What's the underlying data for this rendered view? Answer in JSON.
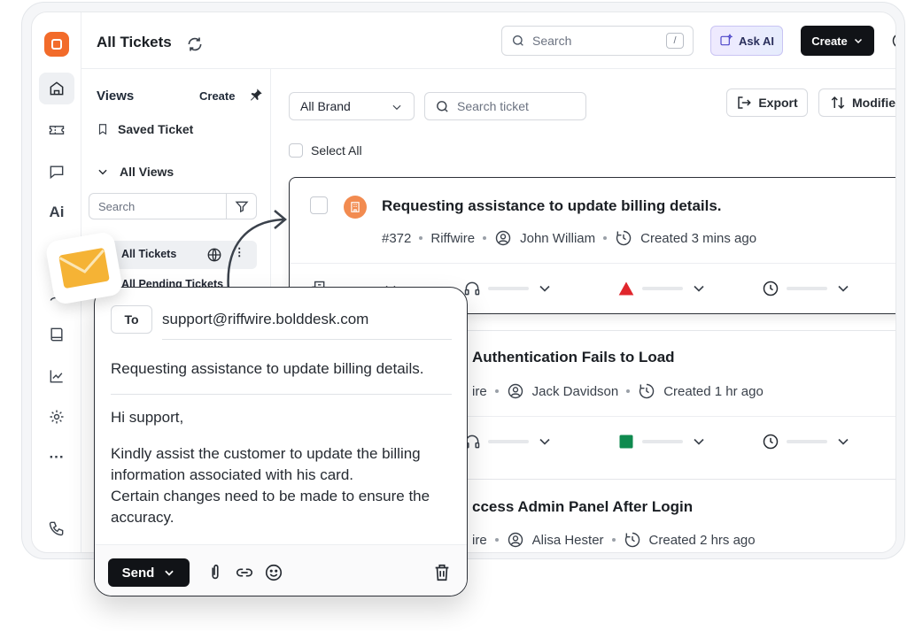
{
  "header": {
    "title": "All Tickets",
    "search_placeholder": "Search",
    "search_shortcut": "/",
    "ask_ai": "Ask AI",
    "create": "Create"
  },
  "rail": {
    "ai_label": "Ai",
    "more_label": "···"
  },
  "views": {
    "title": "Views",
    "create": "Create",
    "saved": "Saved Ticket",
    "all_views": "All Views",
    "search_placeholder": "Search",
    "items": [
      {
        "label": "All Tickets"
      },
      {
        "label": "All Pending Tickets"
      }
    ]
  },
  "toolbar": {
    "brand": "All Brand",
    "search_placeholder": "Search ticket",
    "export": "Export",
    "modified": "Modified",
    "select_all": "Select All"
  },
  "tickets": [
    {
      "title": "Requesting assistance to update billing details.",
      "id": "#372",
      "brand": "Riffwire",
      "agent": "John William",
      "created": "Created 3 mins ago",
      "priority_color": "#e0262c"
    },
    {
      "title": "Authentication Fails to Load",
      "brand": "ire",
      "agent": "Jack Davidson",
      "created": "Created 1 hr ago",
      "priority_color": "#0f8a4f"
    },
    {
      "title": "ccess Admin Panel After Login",
      "brand": "ire",
      "agent": "Alisa Hester",
      "created": "Created 2 hrs ago"
    }
  ],
  "compose": {
    "to_label": "To",
    "to_address": "support@riffwire.bolddesk.com",
    "subject": "Requesting assistance to update billing details.",
    "greeting": "Hi support,",
    "body_lines": [
      "Kindly assist the customer to update the billing",
      "information associated with his card.",
      "Certain changes need to be made to ensure the",
      "accuracy."
    ],
    "send": "Send"
  }
}
